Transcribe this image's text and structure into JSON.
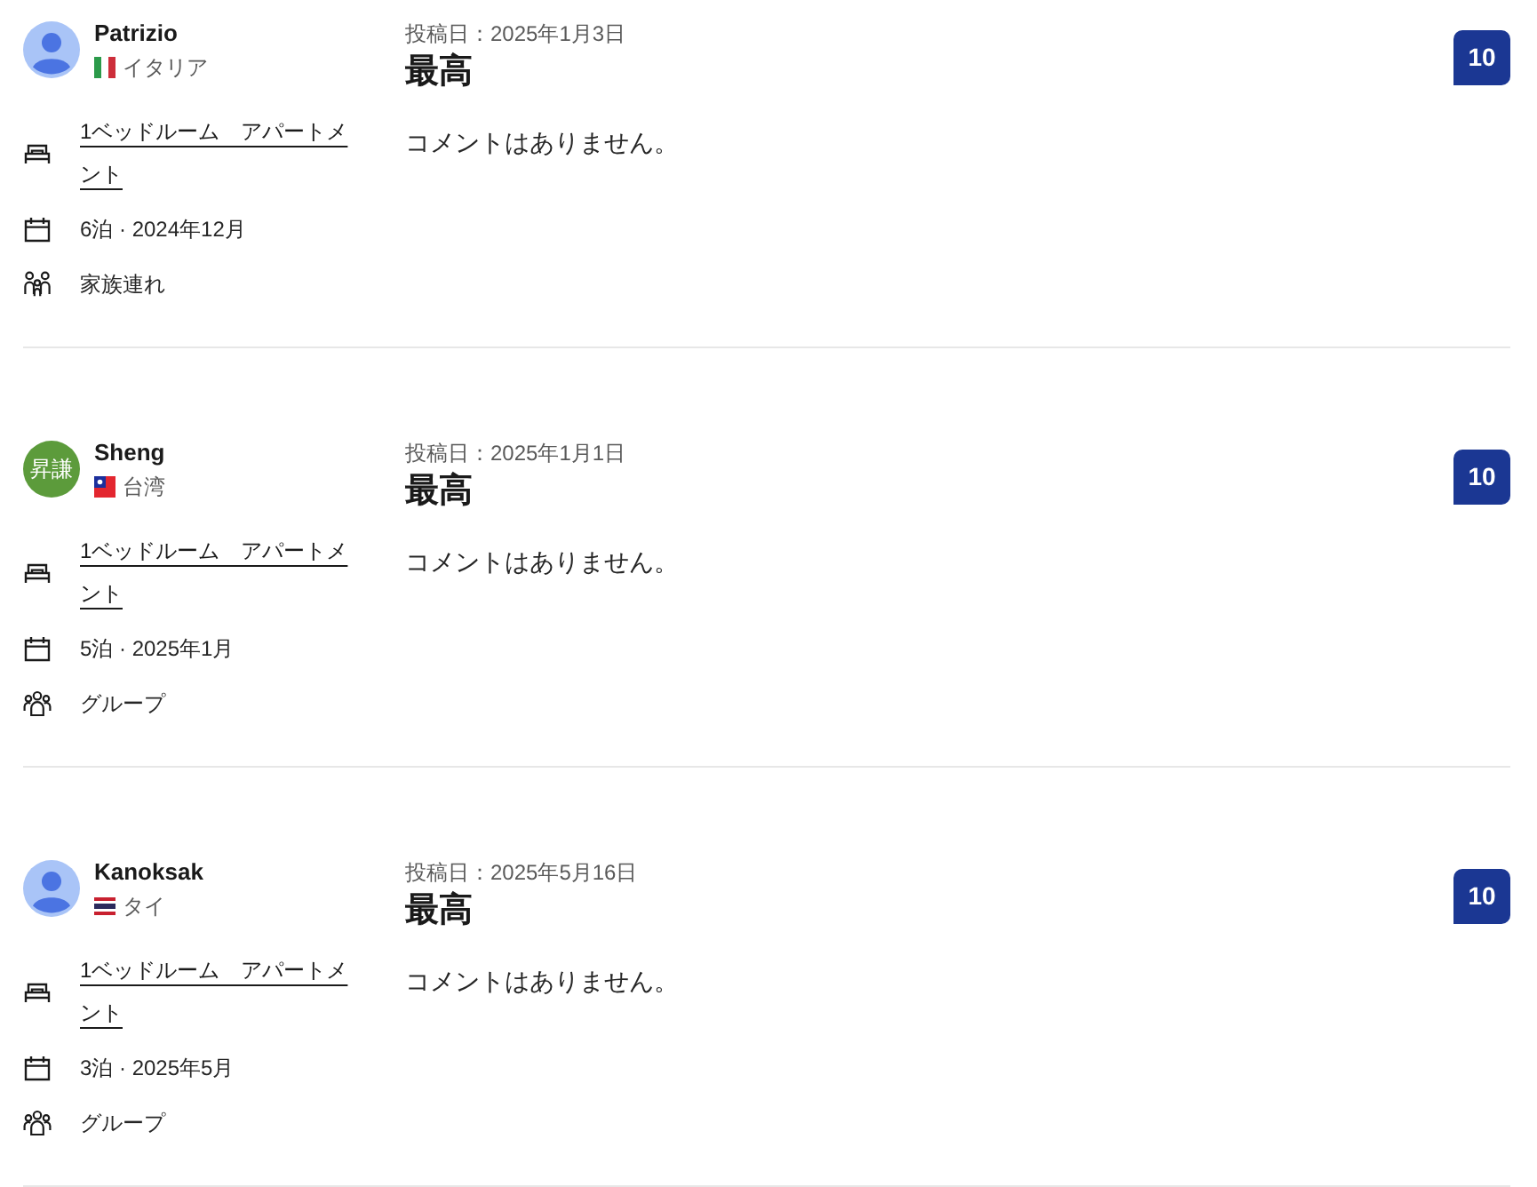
{
  "reviews": [
    {
      "reviewer": {
        "name": "Patrizio",
        "country": "イタリア",
        "flag": {
          "kind": "italy"
        },
        "avatar": {
          "kind": "silhouette"
        }
      },
      "details": [
        {
          "kind": "room",
          "text": "1ベッドルーム　アパートメント"
        },
        {
          "kind": "stay",
          "text": "6泊 · 2024年12月"
        },
        {
          "kind": "family",
          "text": "家族連れ"
        }
      ],
      "posted": "投稿日：2025年1月3日",
      "title": "最高",
      "comment": "コメントはありません。",
      "score": "10"
    },
    {
      "reviewer": {
        "name": "Sheng",
        "country": "台湾",
        "flag": {
          "kind": "taiwan"
        },
        "avatar": {
          "kind": "initials",
          "text": "昇謙",
          "color": "#5c9b3b"
        }
      },
      "details": [
        {
          "kind": "room",
          "text": "1ベッドルーム　アパートメント"
        },
        {
          "kind": "stay",
          "text": "5泊 · 2025年1月"
        },
        {
          "kind": "group",
          "text": "グループ"
        }
      ],
      "posted": "投稿日：2025年1月1日",
      "title": "最高",
      "comment": "コメントはありません。",
      "score": "10"
    },
    {
      "reviewer": {
        "name": "Kanoksak",
        "country": "タイ",
        "flag": {
          "kind": "thailand"
        },
        "avatar": {
          "kind": "silhouette"
        }
      },
      "details": [
        {
          "kind": "room",
          "text": "1ベッドルーム　アパートメント"
        },
        {
          "kind": "stay",
          "text": "3泊 · 2025年5月"
        },
        {
          "kind": "group",
          "text": "グループ"
        }
      ],
      "posted": "投稿日：2025年5月16日",
      "title": "最高",
      "comment": "コメントはありません。",
      "score": "10"
    }
  ]
}
